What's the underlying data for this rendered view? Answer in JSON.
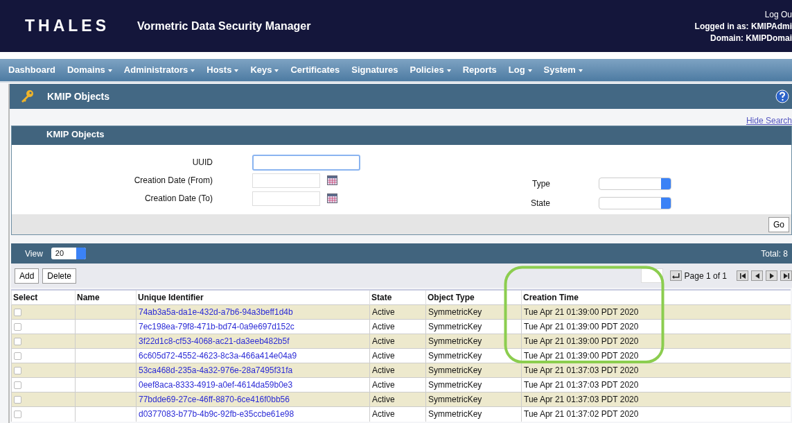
{
  "header": {
    "logo": "THALES",
    "product": "Vormetric Data Security Manager",
    "logout": "Log Ou",
    "logged_in": "Logged in as: KMIPAdmi",
    "domain": "Domain: KMIPDomai"
  },
  "nav": [
    {
      "label": "Dashboard",
      "dropdown": false
    },
    {
      "label": "Domains",
      "dropdown": true
    },
    {
      "label": "Administrators",
      "dropdown": true
    },
    {
      "label": "Hosts",
      "dropdown": true
    },
    {
      "label": "Keys",
      "dropdown": true
    },
    {
      "label": "Certificates",
      "dropdown": false
    },
    {
      "label": "Signatures",
      "dropdown": false
    },
    {
      "label": "Policies",
      "dropdown": true
    },
    {
      "label": "Reports",
      "dropdown": false
    },
    {
      "label": "Log",
      "dropdown": true
    },
    {
      "label": "System",
      "dropdown": true
    }
  ],
  "page_title": "KMIP Objects",
  "hide_search": "Hide Search",
  "search": {
    "title": "KMIP Objects",
    "uuid_label": "UUID",
    "from_label": "Creation Date (From)",
    "to_label": "Creation Date (To)",
    "type_label": "Type",
    "state_label": "State",
    "go": "Go"
  },
  "results": {
    "view_label": "View",
    "view_value": "20",
    "total": "Total: 8",
    "add": "Add",
    "delete": "Delete",
    "page": "Page 1 of 1",
    "columns": [
      "Select",
      "Name",
      "Unique Identifier",
      "State",
      "Object Type",
      "Creation Time"
    ],
    "rows": [
      {
        "checked": false,
        "uuid": "74ab3a5a-da1e-432d-a7b6-94a3beff1d4b",
        "state": "Active",
        "type": "SymmetricKey",
        "time": "Tue Apr 21 01:39:00 PDT 2020"
      },
      {
        "checked": false,
        "uuid": "7ec198ea-79f8-471b-bd74-0a9e697d152c",
        "state": "Active",
        "type": "SymmetricKey",
        "time": "Tue Apr 21 01:39:00 PDT 2020"
      },
      {
        "checked": false,
        "uuid": "3f22d1c8-cf53-4068-ac21-da3eeb482b5f",
        "state": "Active",
        "type": "SymmetricKey",
        "time": "Tue Apr 21 01:39:00 PDT 2020"
      },
      {
        "checked": false,
        "uuid": "6c605d72-4552-4623-8c3a-466a414e04a9",
        "state": "Active",
        "type": "SymmetricKey",
        "time": "Tue Apr 21 01:39:00 PDT 2020"
      },
      {
        "checked": false,
        "uuid": "53ca468d-235a-4a32-976e-28a7495f31fa",
        "state": "Active",
        "type": "SymmetricKey",
        "time": "Tue Apr 21 01:37:03 PDT 2020"
      },
      {
        "checked": false,
        "uuid": "0eef8aca-8333-4919-a0ef-4614da59b0e3",
        "state": "Active",
        "type": "SymmetricKey",
        "time": "Tue Apr 21 01:37:03 PDT 2020"
      },
      {
        "checked": false,
        "uuid": "77bdde69-27ce-46ff-8870-6ce416f0bb56",
        "state": "Active",
        "type": "SymmetricKey",
        "time": "Tue Apr 21 01:37:03 PDT 2020"
      },
      {
        "checked": false,
        "uuid": "d0377083-b77b-4b9c-92fb-e35ccbe61e98",
        "state": "Active",
        "type": "SymmetricKey",
        "time": "Tue Apr 21 01:37:02 PDT 2020"
      }
    ]
  }
}
